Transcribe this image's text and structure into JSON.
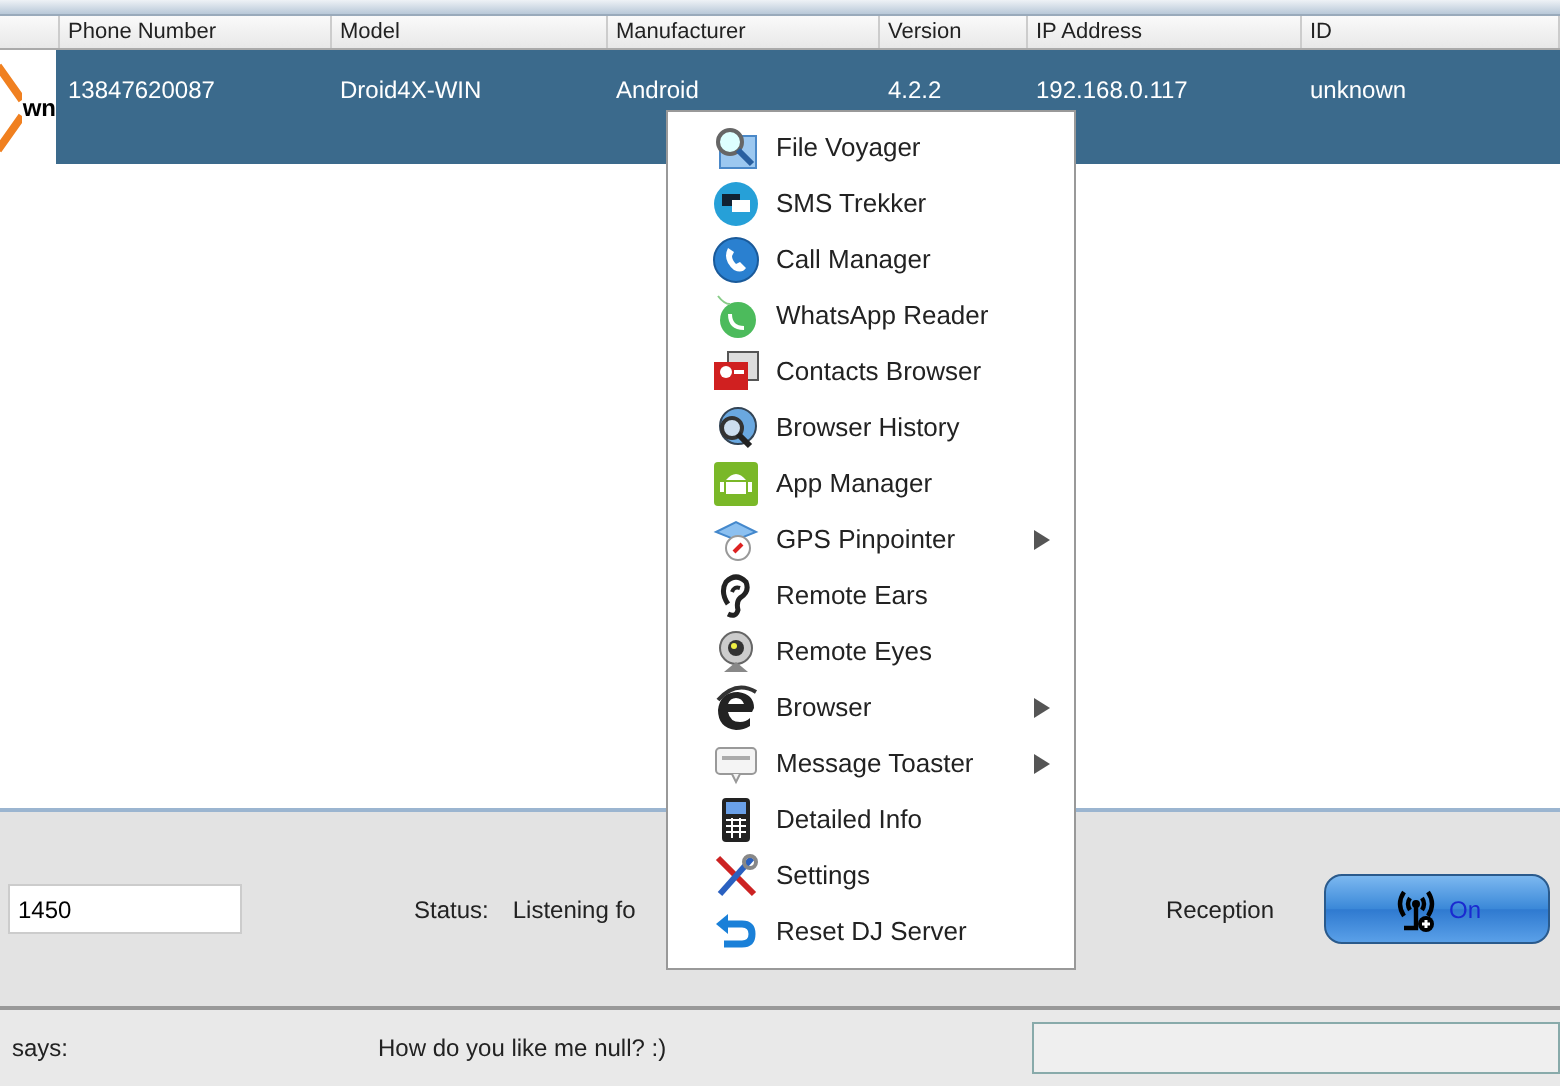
{
  "table": {
    "columns": [
      "",
      "Phone Number",
      "Model",
      "Manufacturer",
      "Version",
      "IP Address",
      "ID"
    ],
    "rows": [
      {
        "selected": true,
        "cells": [
          "wn",
          "13847620087",
          "Droid4X-WIN",
          "Android",
          "4.2.2",
          "192.168.0.117",
          "unknown"
        ]
      }
    ]
  },
  "context_menu": [
    {
      "label": "File Voyager",
      "submenu": false
    },
    {
      "label": "SMS Trekker",
      "submenu": false
    },
    {
      "label": "Call Manager",
      "submenu": false
    },
    {
      "label": "WhatsApp Reader",
      "submenu": false
    },
    {
      "label": "Contacts Browser",
      "submenu": false
    },
    {
      "label": "Browser History",
      "submenu": false
    },
    {
      "label": "App Manager",
      "submenu": false
    },
    {
      "label": "GPS Pinpointer",
      "submenu": true
    },
    {
      "label": "Remote Ears",
      "submenu": false
    },
    {
      "label": "Remote Eyes",
      "submenu": false
    },
    {
      "label": "Browser",
      "submenu": true
    },
    {
      "label": "Message Toaster",
      "submenu": true
    },
    {
      "label": "Detailed Info",
      "submenu": false
    },
    {
      "label": "Settings",
      "submenu": false
    },
    {
      "label": "Reset DJ Server",
      "submenu": false
    }
  ],
  "control_panel": {
    "port": "1450",
    "status_label": "Status:",
    "status_text": "Listening fo",
    "reception_label": "Reception",
    "reception_button": "On",
    "reception_on": true
  },
  "chat_bar": {
    "sender": "says:",
    "message": "How do you like me null? :)"
  }
}
